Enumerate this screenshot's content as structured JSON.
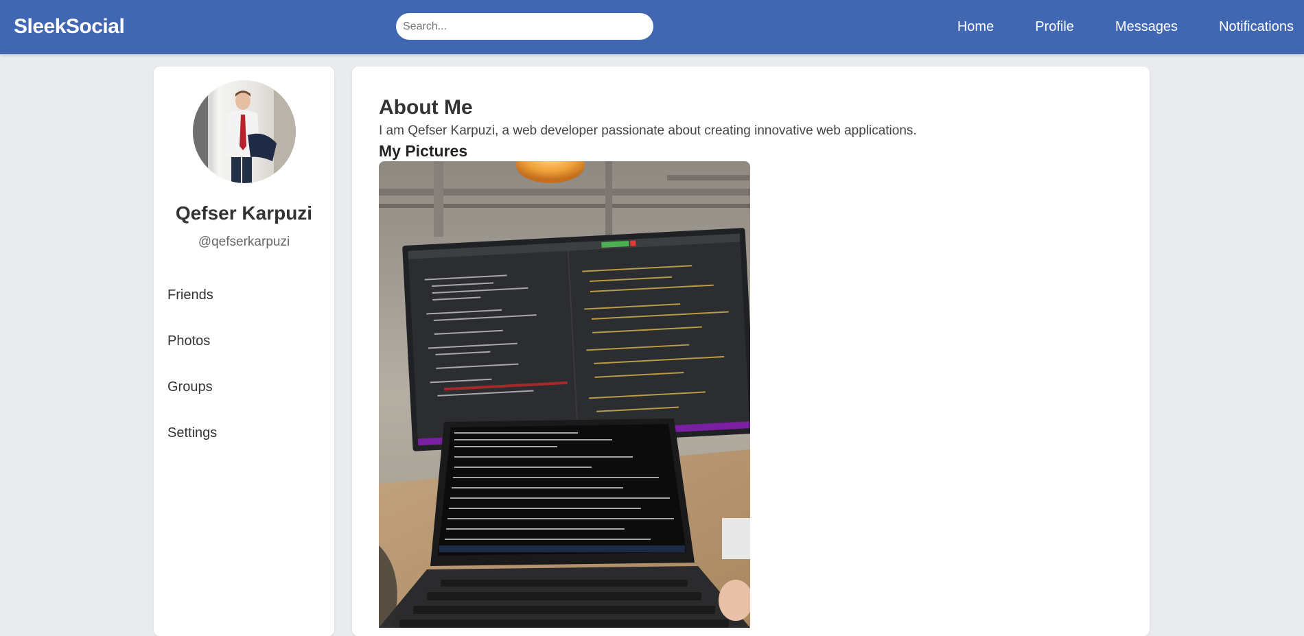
{
  "header": {
    "brand": "SleekSocial",
    "search_placeholder": "Search...",
    "nav": [
      "Home",
      "Profile",
      "Messages",
      "Notifications"
    ]
  },
  "profile": {
    "name": "Qefser Karpuzi",
    "handle": "@qefserkarpuzi",
    "avatar_icon": "user-avatar-photo"
  },
  "sidebar": {
    "items": [
      "Friends",
      "Photos",
      "Groups",
      "Settings"
    ]
  },
  "main": {
    "about_title": "About Me",
    "about_text": "I am Qefser Karpuzi, a web developer passionate about creating innovative web applications.",
    "pictures_title": "My Pictures",
    "pictures": [
      {
        "icon": "desk-setup-photo"
      }
    ]
  },
  "colors": {
    "header_bg": "#4267b2",
    "page_bg": "#e9ebee",
    "card_bg": "#ffffff",
    "text": "#333333"
  }
}
